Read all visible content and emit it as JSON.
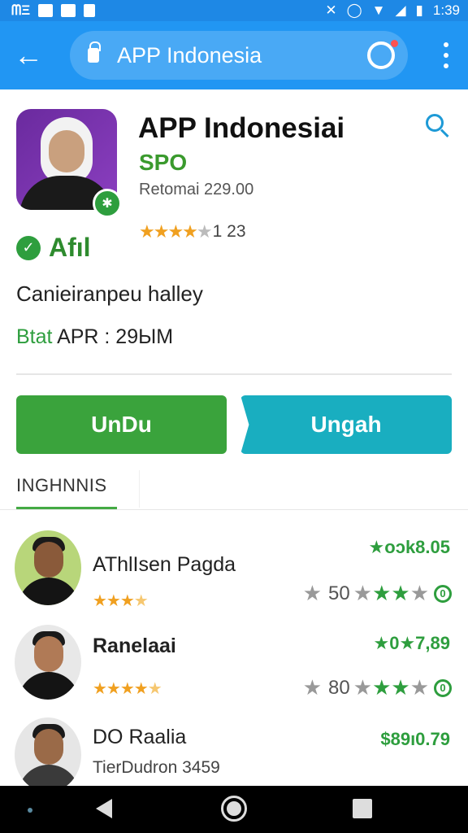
{
  "status_bar": {
    "left_text": "ᗰΞ",
    "time": "1:39"
  },
  "browser": {
    "url_text": "APP Indonesia"
  },
  "app": {
    "title": "APP Indonesiai",
    "developer": "SPO",
    "meta": "Retomai 229.00",
    "rating_count": "1 23",
    "rating_value": 4,
    "verified_label": "Afıl",
    "description": "Canieiranpeu halley",
    "size_key": "Btat",
    "size_text": "APR : 29ЫM"
  },
  "buttons": {
    "download": "UnDu",
    "update": "Ungah"
  },
  "tab": {
    "label": "INGHNNIS"
  },
  "reviews": [
    {
      "name": "AThlIsen Pagda",
      "price": "★oɔk8.05",
      "rating_num": "50",
      "stars_value": 3.5
    },
    {
      "name": "Ranelaai",
      "price": "★0★7,89",
      "rating_num": "80",
      "stars_value": 4.5
    },
    {
      "name": "DO Raalia",
      "price": "$89ı0.79",
      "subtitle": "TierDudron  3459"
    }
  ],
  "colors": {
    "brand_blue": "#2196f3",
    "green": "#3aa33c",
    "teal": "#19aec0",
    "star": "#f0a020"
  }
}
